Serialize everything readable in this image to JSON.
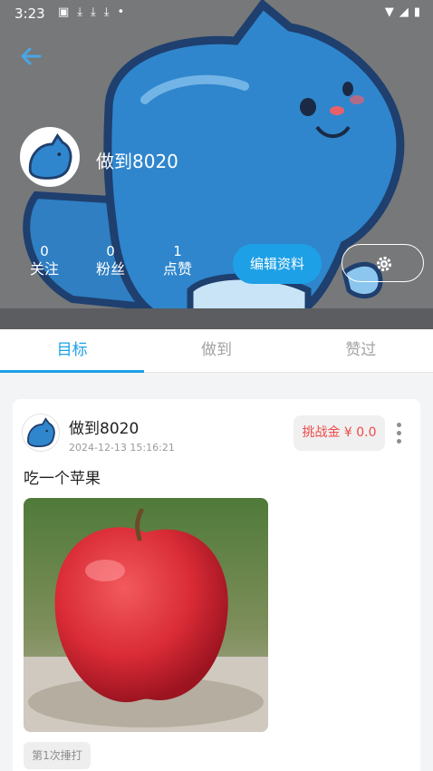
{
  "status_bar": {
    "time": "3:23"
  },
  "profile": {
    "username": "做到8020",
    "stats": [
      {
        "count": "0",
        "label": "关注"
      },
      {
        "count": "0",
        "label": "粉丝"
      },
      {
        "count": "1",
        "label": "点赞"
      }
    ],
    "edit_label": "编辑资料"
  },
  "tabs": [
    {
      "label": "目标",
      "active": true
    },
    {
      "label": "做到",
      "active": false
    },
    {
      "label": "赞过",
      "active": false
    }
  ],
  "post": {
    "username": "做到8020",
    "timestamp": "2024-12-13 15:16:21",
    "challenge_label": "挑战金 ¥ 0.0",
    "text": "吃一个苹果",
    "checkin_label": "第1次捶打"
  },
  "colors": {
    "accent": "#1ea0e6",
    "challenge_text": "#f04a4a",
    "cover_bg": "#77797a"
  }
}
